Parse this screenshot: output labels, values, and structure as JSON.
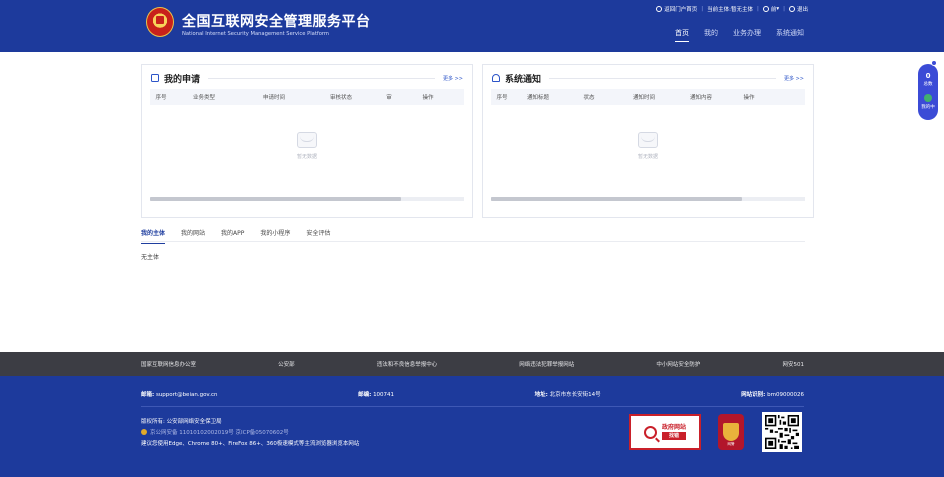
{
  "header": {
    "title": "全国互联网安全管理服务平台",
    "subtitle": "National Internet Security Management Service Platform",
    "topbar": {
      "portal": "返回门户首页",
      "subject_label": "当前主体:",
      "subject_value": "暂无主体",
      "user": "前",
      "logout": "退出"
    },
    "nav": [
      "首页",
      "我的",
      "业务办理",
      "系统通知"
    ],
    "active_nav": 0
  },
  "applications": {
    "title": "我的申请",
    "more": "更多 >>",
    "columns": [
      "序号",
      "业务类型",
      "申请时间",
      "审核状态",
      "审",
      "操作"
    ],
    "empty_text": "暂无数据"
  },
  "notifications": {
    "title": "系统通知",
    "more": "更多 >>",
    "columns": [
      "序号",
      "通知标题",
      "状态",
      "通知时间",
      "通知内容",
      "操作"
    ],
    "empty_text": "暂无数据"
  },
  "tabs": {
    "items": [
      "我的主体",
      "我的网站",
      "我的APP",
      "我的小程序",
      "安全评估"
    ],
    "active": 0,
    "content": "无主体"
  },
  "float_widget": {
    "count": "0",
    "count_label": "总数",
    "status_label": "我的中"
  },
  "footer": {
    "links": [
      "国家互联网信息办公室",
      "公安部",
      "违法和不良信息举报中心",
      "网络违法犯罪举报网站",
      "中小网站安全防护",
      "网安501"
    ],
    "contact": {
      "email_label": "邮箱:",
      "email": "support@beian.gov.cn",
      "zip_label": "邮编:",
      "zip": "100741",
      "addr_label": "地址:",
      "addr": "北京市东长安街14号",
      "cert_label": "网站识别:",
      "cert": "bm09000026"
    },
    "copyright": "版权所有: 公安部网络安全保卫局",
    "filing": "京公网安备 11010102002019号    京ICP备05070602号",
    "browser_tip": "建议您使用Edge、Chrome 80+、FireFox 86+、360极速模式等主流浏览器浏览本网站",
    "gov_badge": {
      "line1": "政府网站",
      "line2": "找错"
    },
    "police_badge": "网警",
    "brand_color": "#1d3a9c",
    "link_bar_color": "#3c3d44"
  }
}
